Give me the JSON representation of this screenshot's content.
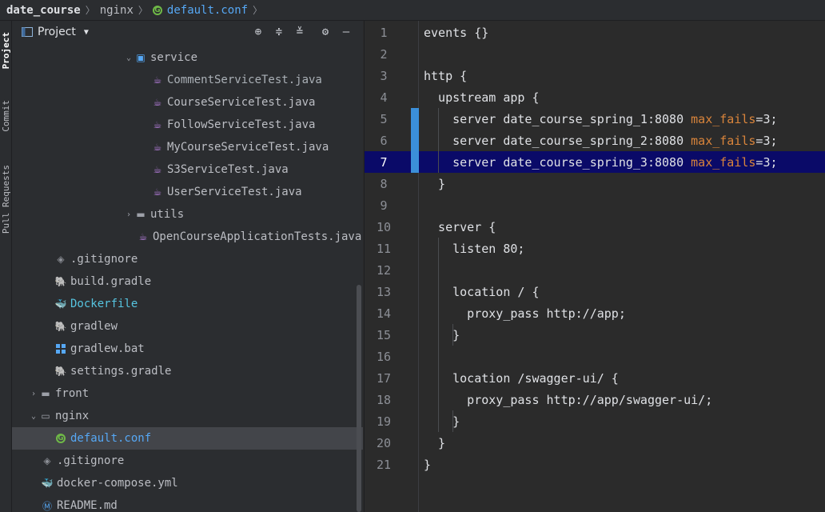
{
  "breadcrumb": {
    "root": "date_course",
    "folder": "nginx",
    "file": "default.conf",
    "separator": "〉"
  },
  "tool_strip": {
    "tabs": [
      "Project",
      "Commit",
      "Pull Requests"
    ]
  },
  "project_panel": {
    "title": "Project",
    "tree": [
      {
        "label": "service",
        "icon": "folder-service-icon",
        "arrow": "expanded"
      },
      {
        "label": "CommentServiceTest.java",
        "icon": "java-class-icon"
      },
      {
        "label": "CourseServiceTest.java",
        "icon": "java-class-icon"
      },
      {
        "label": "FollowServiceTest.java",
        "icon": "java-class-icon"
      },
      {
        "label": "MyCourseServiceTest.java",
        "icon": "java-class-icon"
      },
      {
        "label": "S3ServiceTest.java",
        "icon": "java-class-icon"
      },
      {
        "label": "UserServiceTest.java",
        "icon": "java-class-icon"
      },
      {
        "label": "utils",
        "icon": "folder-icon",
        "arrow": "collapsed"
      },
      {
        "label": "OpenCourseApplicationTests.java",
        "icon": "java-class-icon"
      },
      {
        "label": ".gitignore",
        "icon": "gitignore-icon"
      },
      {
        "label": "build.gradle",
        "icon": "gradle-icon"
      },
      {
        "label": "Dockerfile",
        "icon": "docker-icon"
      },
      {
        "label": "gradlew",
        "icon": "gradle-icon"
      },
      {
        "label": "gradlew.bat",
        "icon": "windows-icon"
      },
      {
        "label": "settings.gradle",
        "icon": "gradle-icon"
      },
      {
        "label": "front",
        "icon": "folder-icon",
        "arrow": "collapsed"
      },
      {
        "label": "nginx",
        "icon": "folder-icon",
        "arrow": "expanded"
      },
      {
        "label": "default.conf",
        "icon": "conf-icon"
      },
      {
        "label": ".gitignore",
        "icon": "gitignore-icon"
      },
      {
        "label": "docker-compose.yml",
        "icon": "docker-icon"
      },
      {
        "label": "README.md",
        "icon": "markdown-icon"
      }
    ]
  },
  "editor": {
    "current_line": 7,
    "lines": [
      {
        "n": "1",
        "text": "events {}"
      },
      {
        "n": "2",
        "text": ""
      },
      {
        "n": "3",
        "text": "http {"
      },
      {
        "n": "4",
        "text": "  upstream app {"
      },
      {
        "n": "5",
        "pre": "    server date_course_spring_1:8080 ",
        "attr": "max_fails",
        "post": "=3;"
      },
      {
        "n": "6",
        "pre": "    server date_course_spring_2:8080 ",
        "attr": "max_fails",
        "post": "=3;"
      },
      {
        "n": "7",
        "pre": "    server date_course_spring_3:8080 ",
        "attr": "max_fails",
        "post": "=3;"
      },
      {
        "n": "8",
        "text": "  }"
      },
      {
        "n": "9",
        "text": ""
      },
      {
        "n": "10",
        "text": "  server {"
      },
      {
        "n": "11",
        "text": "    listen 80;"
      },
      {
        "n": "12",
        "text": ""
      },
      {
        "n": "13",
        "text": "    location / {"
      },
      {
        "n": "14",
        "text": "      proxy_pass http://app;"
      },
      {
        "n": "15",
        "text": "    }"
      },
      {
        "n": "16",
        "text": ""
      },
      {
        "n": "17",
        "text": "    location /swagger-ui/ {"
      },
      {
        "n": "18",
        "text": "      proxy_pass http://app/swagger-ui/;"
      },
      {
        "n": "19",
        "text": "    }"
      },
      {
        "n": "20",
        "text": "  }"
      },
      {
        "n": "21",
        "text": "}"
      }
    ]
  }
}
